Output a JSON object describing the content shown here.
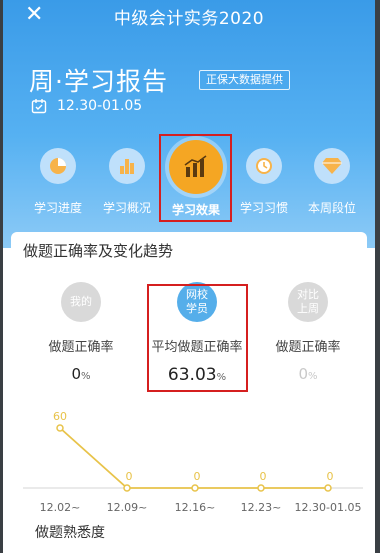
{
  "app": {
    "title": "中级会计实务2020"
  },
  "report": {
    "title": "周·学习报告",
    "badge": "正保大数据提供",
    "date_range": "12.30-01.05"
  },
  "tabs": [
    {
      "label": "学习进度",
      "icon": "pie-chart-icon"
    },
    {
      "label": "学习概况",
      "icon": "bar-chart-icon"
    },
    {
      "label": "学习效果",
      "icon": "growth-bars-icon"
    },
    {
      "label": "学习习惯",
      "icon": "clock-icon"
    },
    {
      "label": "本周段位",
      "icon": "diamond-icon"
    }
  ],
  "section": {
    "title": "做题正确率及变化趋势"
  },
  "stats": [
    {
      "bubble_lines": [
        "我的"
      ],
      "name": "做题正确率",
      "value": "0",
      "unit": "%"
    },
    {
      "bubble_lines": [
        "网校",
        "学员"
      ],
      "name": "平均做题正确率",
      "value": "63.03",
      "unit": "%"
    },
    {
      "bubble_lines": [
        "对比",
        "上周"
      ],
      "name": "做题正确率",
      "value": "0",
      "unit": "%"
    }
  ],
  "colors": {
    "accent": "#f5a623",
    "hero_blue": "#3a9be8",
    "line": "#e8c34a",
    "highlight": "#d51f1f"
  },
  "chart_data": {
    "type": "line",
    "categories": [
      "12.02~",
      "12.09~",
      "12.16~",
      "12.23~",
      "12.30-01.05"
    ],
    "values": [
      60,
      0,
      0,
      0,
      0
    ],
    "data_labels": [
      "60",
      "0",
      "0",
      "0",
      "0"
    ]
  },
  "footer": {
    "title": "做题熟悉度"
  }
}
